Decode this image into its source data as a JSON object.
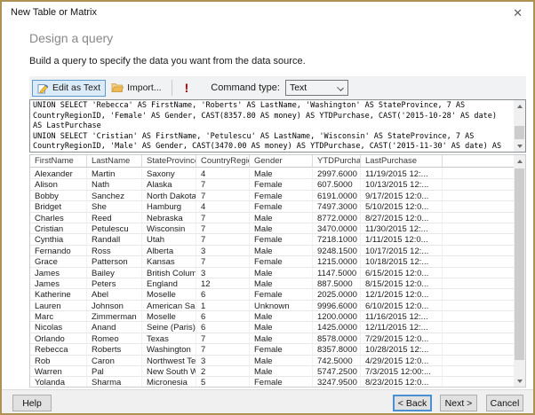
{
  "window": {
    "title": "New Table or Matrix",
    "close_glyph": "✕"
  },
  "page": {
    "heading": "Design a query",
    "description": "Build a query to specify the data you want from the data source."
  },
  "toolbar": {
    "edit_as_text_label": "Edit as Text",
    "edit_as_text_selected": true,
    "import_label": "Import...",
    "execute_glyph": "!",
    "command_type_label": "Command type:",
    "command_type_value": "Text",
    "icons": {
      "edit_as_text": "pencil-document-icon",
      "import": "folder-open-icon",
      "execute": "exclamation-run-icon",
      "command_type": "chevron-down-icon"
    }
  },
  "query": {
    "sql": "UNION SELECT 'Rebecca' AS FirstName, 'Roberts' AS LastName, 'Washington' AS StateProvince, 7 AS\nCountryRegionID, 'Female' AS Gender, CAST(8357.80 AS money) AS YTDPurchase, CAST('2015-10-28' AS date)\nAS LastPurchase\nUNION SELECT 'Cristian' AS FirstName, 'Petulescu' AS LastName, 'Wisconsin' AS StateProvince, 7 AS\nCountryRegionID, 'Male' AS Gender, CAST(3470.00 AS money) AS YTDPurchase, CAST('2015-11-30' AS date) AS"
  },
  "grid": {
    "columns": [
      "FirstName",
      "LastName",
      "StateProvince",
      "CountryRegionID",
      "Gender",
      "YTDPurchase",
      "LastPurchase"
    ],
    "rows": [
      [
        "Alexander",
        "Martin",
        "Saxony",
        "4",
        "Male",
        "2997.6000",
        "11/19/2015 12:..."
      ],
      [
        "Alison",
        "Nath",
        "Alaska",
        "7",
        "Female",
        "607.5000",
        "10/13/2015 12:..."
      ],
      [
        "Bobby",
        "Sanchez",
        "North Dakota",
        "7",
        "Female",
        "6191.0000",
        "9/17/2015 12:0..."
      ],
      [
        "Bridget",
        "She",
        "Hamburg",
        "4",
        "Female",
        "7497.3000",
        "5/10/2015 12:0..."
      ],
      [
        "Charles",
        "Reed",
        "Nebraska",
        "7",
        "Male",
        "8772.0000",
        "8/27/2015 12:0..."
      ],
      [
        "Cristian",
        "Petulescu",
        "Wisconsin",
        "7",
        "Male",
        "3470.0000",
        "11/30/2015 12:..."
      ],
      [
        "Cynthia",
        "Randall",
        "Utah",
        "7",
        "Female",
        "7218.1000",
        "1/11/2015 12:0..."
      ],
      [
        "Fernando",
        "Ross",
        "Alberta",
        "3",
        "Male",
        "9248.1500",
        "10/17/2015 12:..."
      ],
      [
        "Grace",
        "Patterson",
        "Kansas",
        "7",
        "Female",
        "1215.0000",
        "10/18/2015 12:..."
      ],
      [
        "James",
        "Bailey",
        "British Columbia",
        "3",
        "Male",
        "1147.5000",
        "6/15/2015 12:0..."
      ],
      [
        "James",
        "Peters",
        "England",
        "12",
        "Male",
        "887.5000",
        "8/15/2015 12:0..."
      ],
      [
        "Katherine",
        "Abel",
        "Moselle",
        "6",
        "Female",
        "2025.0000",
        "12/1/2015 12:0..."
      ],
      [
        "Lauren",
        "Johnson",
        "American Samoa",
        "1",
        "Unknown",
        "9996.6000",
        "6/10/2015 12:0..."
      ],
      [
        "Marc",
        "Zimmerman",
        "Moselle",
        "6",
        "Male",
        "1200.0000",
        "11/16/2015 12:..."
      ],
      [
        "Nicolas",
        "Anand",
        "Seine (Paris)",
        "6",
        "Male",
        "1425.0000",
        "12/11/2015 12:..."
      ],
      [
        "Orlando",
        "Romeo",
        "Texas",
        "7",
        "Male",
        "8578.0000",
        "7/29/2015 12:0..."
      ],
      [
        "Rebecca",
        "Roberts",
        "Washington",
        "7",
        "Female",
        "8357.8000",
        "10/28/2015 12:..."
      ],
      [
        "Rob",
        "Caron",
        "Northwest Terri...",
        "3",
        "Male",
        "742.5000",
        "4/29/2015 12:0..."
      ],
      [
        "Warren",
        "Pal",
        "New South Wales",
        "2",
        "Male",
        "5747.2500",
        "7/3/2015 12:00:..."
      ],
      [
        "Yolanda",
        "Sharma",
        "Micronesia",
        "5",
        "Female",
        "3247.9500",
        "8/23/2015 12:0..."
      ]
    ]
  },
  "footer": {
    "help_label": "Help",
    "back_label": "< Back",
    "next_label": "Next >",
    "cancel_label": "Cancel"
  },
  "colors": {
    "dialog_border": "#ae9254",
    "selected_tool_bg": "#dcebf8",
    "selected_tool_border": "#5c9ccc",
    "execute_red": "#b00000",
    "focus_border": "#4a90d2"
  }
}
